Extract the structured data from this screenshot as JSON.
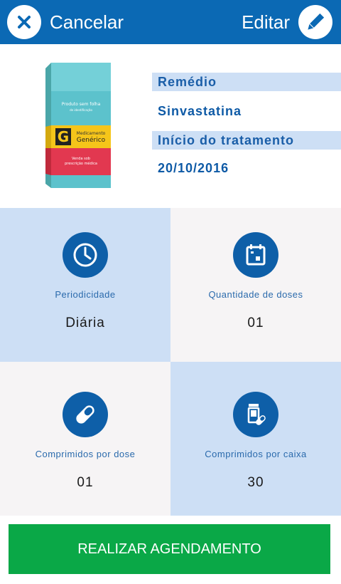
{
  "header": {
    "cancel_label": "Cancelar",
    "edit_label": "Editar",
    "background": "#0b69b4"
  },
  "package": {
    "text_line1": "Produto sem folha",
    "text_line2": "de identificação",
    "brand_line1": "Medicamento",
    "brand_line2": "Genérico",
    "bottom_line1": "Venda sob",
    "bottom_line2": "prescrição médica"
  },
  "info": {
    "drug_label": "Remédio",
    "drug_value": "Sinvastatina",
    "start_label": "Início do tratamento",
    "start_value": "20/10/2016"
  },
  "tiles": [
    {
      "icon": "clock-icon",
      "label": "Periodicidade",
      "value": "Diária"
    },
    {
      "icon": "calendar-icon",
      "label": "Quantidade de doses",
      "value": "01"
    },
    {
      "icon": "pill-icon",
      "label": "Comprimidos por dose",
      "value": "01"
    },
    {
      "icon": "pill-box-icon",
      "label": "Comprimidos por caixa",
      "value": "30"
    }
  ],
  "cta": {
    "label": "REALIZAR AGENDAMENTO",
    "color": "#0aa847"
  },
  "colors": {
    "accent": "#0e5fa8",
    "tile_blue": "#cddff5",
    "tile_gray": "#f6f4f5"
  }
}
